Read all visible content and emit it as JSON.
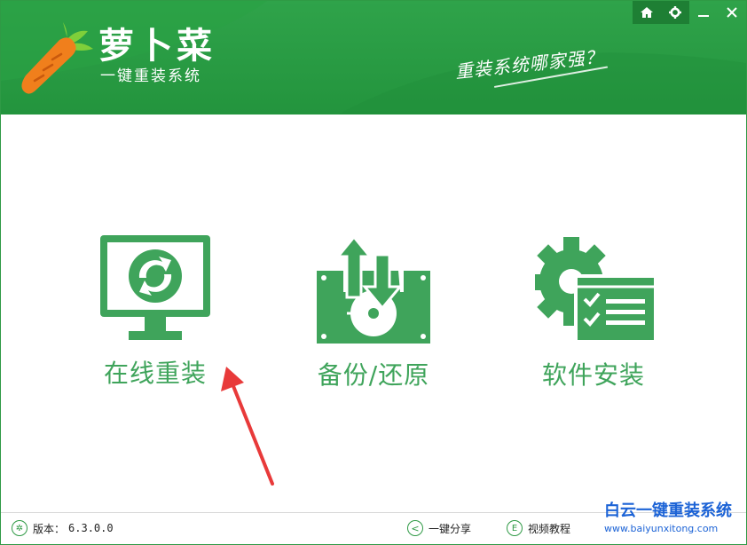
{
  "header": {
    "brand_title": "萝卜菜",
    "brand_subtitle": "一键重装系统",
    "slogan": "重装系统哪家强？",
    "window_buttons": [
      "home-icon",
      "gear-icon",
      "minimize-icon",
      "close-icon"
    ]
  },
  "features": [
    {
      "label": "在线重装",
      "icon": "monitor-refresh-icon"
    },
    {
      "label": "备份/还原",
      "icon": "backup-restore-icon"
    },
    {
      "label": "软件安装",
      "icon": "software-install-icon"
    }
  ],
  "footer": {
    "version_label": "版本：",
    "version_value": "6.3.0.0",
    "share_label": "一键分享",
    "video_label": "视频教程"
  },
  "watermark": {
    "text": "白云一键重装系统",
    "url": "www.baiyunxitong.com"
  },
  "colors": {
    "header_green": "#23943d",
    "feature_green": "#3fa45b",
    "carrot_orange": "#f07f1c",
    "watermark_blue": "#1c63d6",
    "arrow_red": "#e83a3a"
  }
}
